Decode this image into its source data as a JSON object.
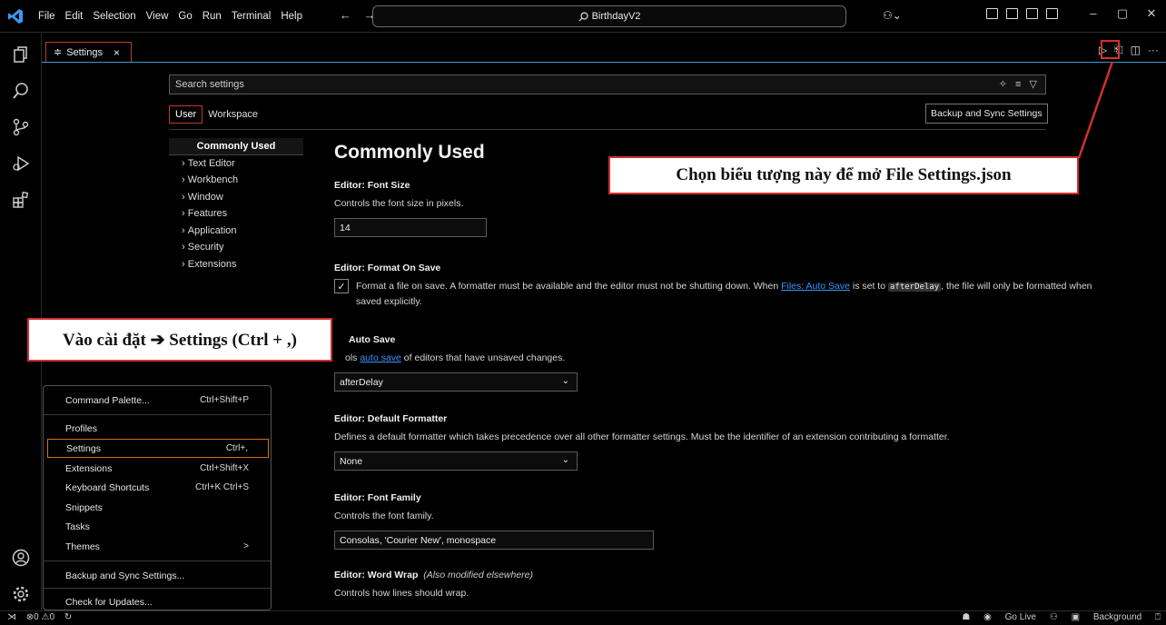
{
  "menubar": [
    "File",
    "Edit",
    "Selection",
    "View",
    "Go",
    "Run",
    "Terminal",
    "Help"
  ],
  "titlebar": {
    "search_text": "BirthdayV2",
    "back": "←",
    "forward": "→"
  },
  "tab": {
    "label": "Settings",
    "close": "×"
  },
  "search": {
    "placeholder": "Search settings"
  },
  "scope": {
    "user": "User",
    "workspace": "Workspace"
  },
  "sync_button": "Backup and Sync Settings",
  "toc": [
    "Commonly Used",
    "Text Editor",
    "Workbench",
    "Window",
    "Features",
    "Application",
    "Security",
    "Extensions"
  ],
  "content": {
    "section_title": "Commonly Used",
    "font_size": {
      "title": "Editor: Font Size",
      "desc": "Controls the font size in pixels.",
      "value": "14"
    },
    "format_on_save": {
      "title": "Editor: Format On Save",
      "desc_a": "Format a file on save. A formatter must be available and the editor must not be shutting down. When ",
      "link": "Files: Auto Save",
      "desc_b": " is set to ",
      "code": "afterDelay",
      "desc_c": ", the file will only be formatted when saved explicitly."
    },
    "auto_save": {
      "title": "Auto Save",
      "desc_a": "ols ",
      "link": "auto save",
      "desc_b": " of editors that have unsaved changes.",
      "value": "afterDelay"
    },
    "default_formatter": {
      "title": "Editor: Default Formatter",
      "desc": "Defines a default formatter which takes precedence over all other formatter settings. Must be the identifier of an extension contributing a formatter.",
      "value": "None"
    },
    "font_family": {
      "title": "Editor: Font Family",
      "desc": "Controls the font family.",
      "value": "Consolas, 'Courier New', monospace"
    },
    "word_wrap": {
      "title": "Editor: Word Wrap",
      "note": "(Also modified elsewhere)",
      "desc": "Controls how lines should wrap."
    }
  },
  "menu": [
    {
      "label": "Command Palette...",
      "shortcut": "Ctrl+Shift+P"
    },
    {
      "label": "Profiles",
      "shortcut": ""
    },
    {
      "label": "Settings",
      "shortcut": "Ctrl+,"
    },
    {
      "label": "Extensions",
      "shortcut": "Ctrl+Shift+X"
    },
    {
      "label": "Keyboard Shortcuts",
      "shortcut": "Ctrl+K Ctrl+S"
    },
    {
      "label": "Snippets",
      "shortcut": ""
    },
    {
      "label": "Tasks",
      "shortcut": ""
    },
    {
      "label": "Themes",
      "shortcut": ">"
    },
    {
      "label": "Backup and Sync Settings...",
      "shortcut": ""
    },
    {
      "label": "Check for Updates...",
      "shortcut": ""
    }
  ],
  "annotations": {
    "right": "Chọn biểu tượng này để mở File Settings.json",
    "left": "Vào cài đặt ➔ Settings (Ctrl + ,)"
  },
  "statusbar": {
    "problems": "⊗0 ⚠0",
    "go_live": "Go Live",
    "background": "Background"
  },
  "colors": {
    "accent_blue": "#3a9ad9",
    "annotation_red": "#d32f2f",
    "link": "#3794ff"
  }
}
